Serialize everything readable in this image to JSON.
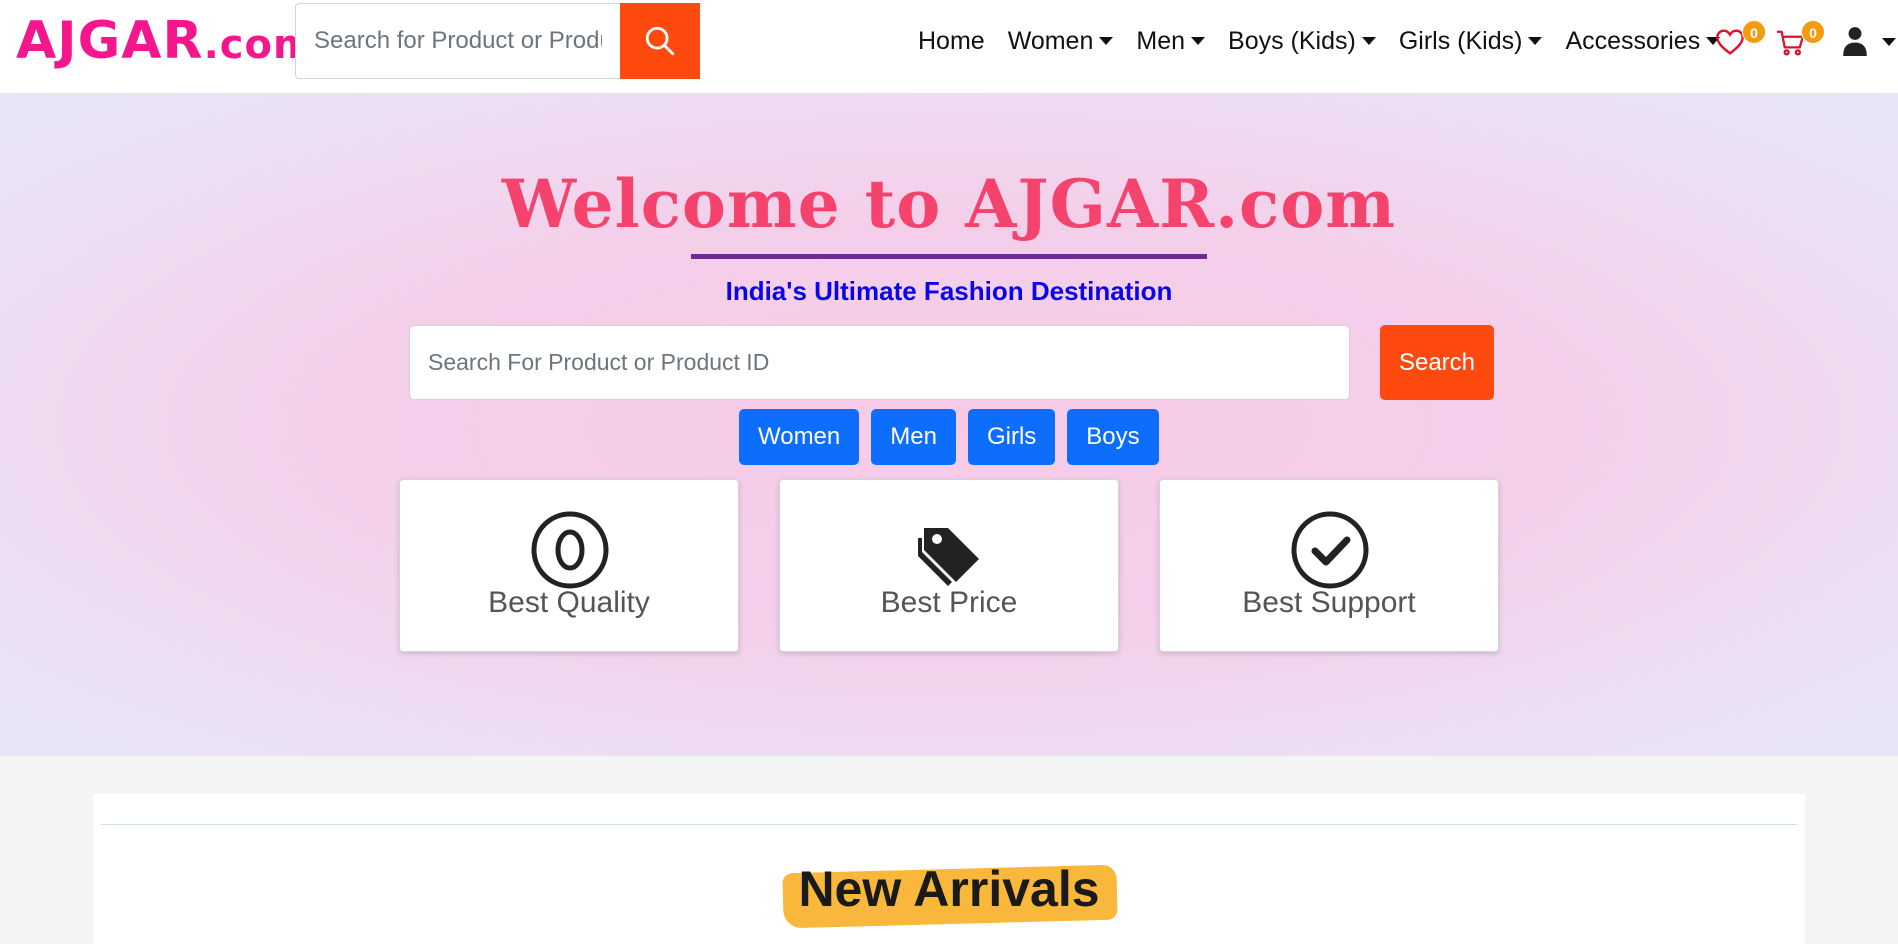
{
  "navbar": {
    "logo_main": "AJGAR",
    "logo_suffix": ".com",
    "search_placeholder": "Search for Product or Product ID",
    "links": [
      {
        "label": "Home",
        "dropdown": false
      },
      {
        "label": "Women",
        "dropdown": true
      },
      {
        "label": "Men",
        "dropdown": true
      },
      {
        "label": "Boys (Kids)",
        "dropdown": true
      },
      {
        "label": "Girls (Kids)",
        "dropdown": true
      },
      {
        "label": "Accessories",
        "dropdown": true
      }
    ],
    "wishlist_count": "0",
    "cart_count": "0",
    "icons": {
      "search": "search-icon",
      "wishlist": "heart-icon",
      "cart": "cart-icon",
      "user": "user-icon"
    }
  },
  "hero": {
    "title": "Welcome to AJGAR.com",
    "subtitle": "India's Ultimate Fashion Destination",
    "search_placeholder": "Search For Product or Product ID",
    "search_button": "Search",
    "categories": [
      "Women",
      "Men",
      "Girls",
      "Boys"
    ],
    "features": [
      {
        "label": "Best Quality",
        "icon": "circle-zero-icon"
      },
      {
        "label": "Best Price",
        "icon": "tags-icon"
      },
      {
        "label": "Best Support",
        "icon": "circle-check-icon"
      }
    ]
  },
  "section": {
    "heading": "New Arrivals"
  },
  "colors": {
    "brand_pink": "#f5168d",
    "accent_orange": "#fe4a0f",
    "title_pink": "#f4436c",
    "subtitle_blue": "#0a05e8",
    "category_blue": "#0d6efd",
    "badge_orange": "#f39c12",
    "highlight_yellow": "#f9b73b"
  }
}
